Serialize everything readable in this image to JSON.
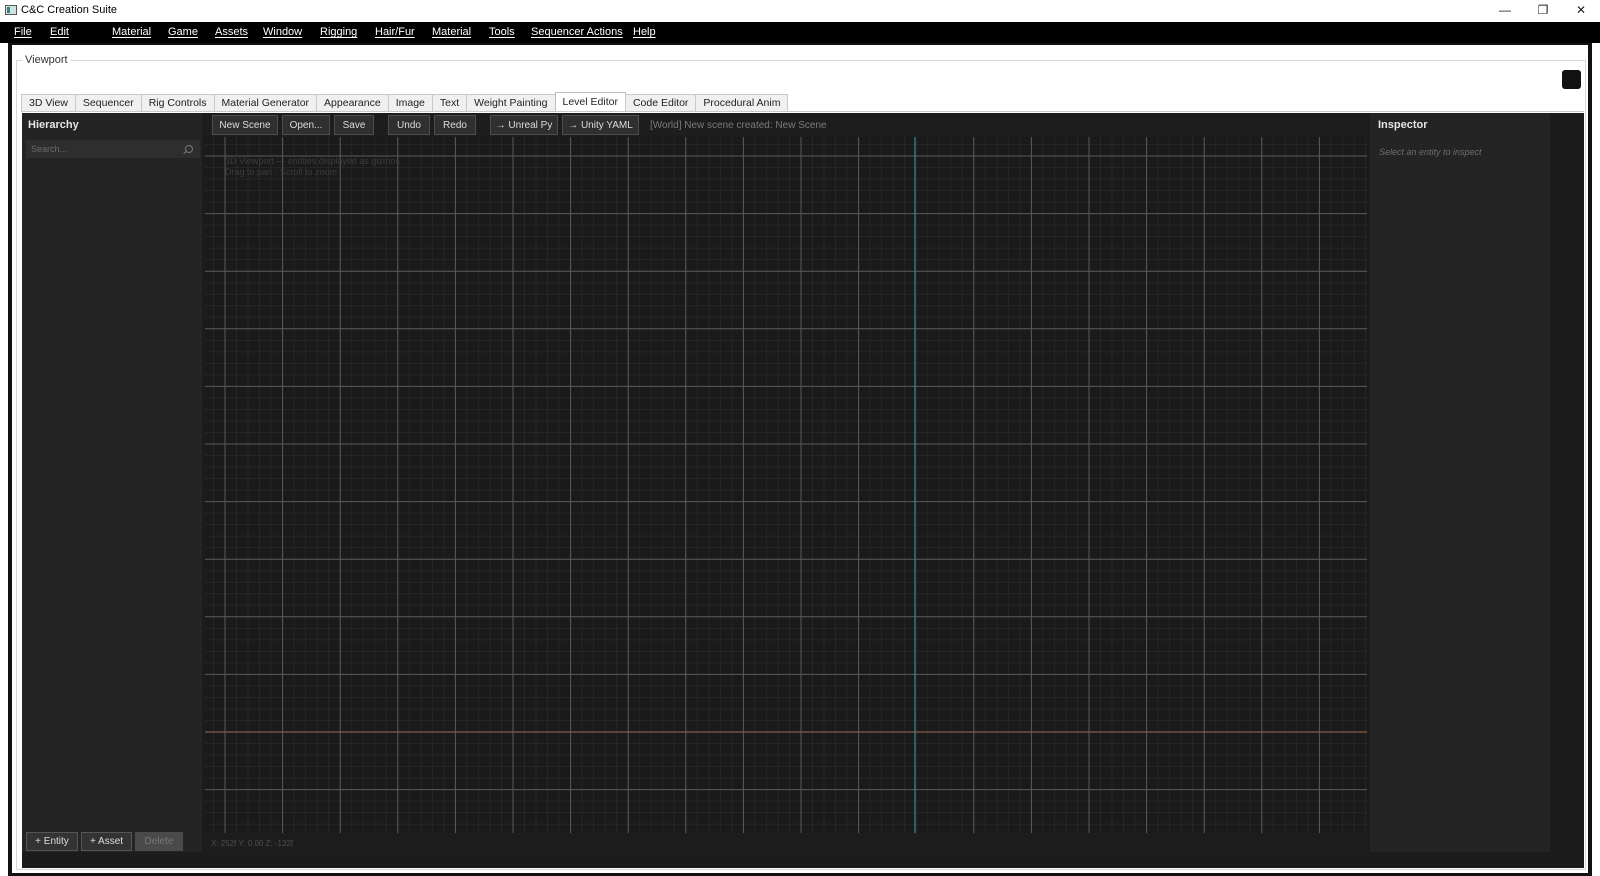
{
  "window": {
    "title": "C&C Creation Suite",
    "controls": [
      "—",
      "❐",
      "✕"
    ]
  },
  "menu": [
    "File",
    "Edit",
    "Material",
    "Game",
    "Assets",
    "Window",
    "Rigging",
    "Hair/Fur",
    "Material",
    "Tools",
    "Sequencer Actions",
    "Help"
  ],
  "groupbox": {
    "title": "Viewport"
  },
  "tabs": [
    "3D View",
    "Sequencer",
    "Rig Controls",
    "Material Generator",
    "Appearance",
    "Image",
    "Text",
    "Weight Painting",
    "Level Editor",
    "Code Editor",
    "Procedural Anim"
  ],
  "active_tab": "Level Editor",
  "hierarchy": {
    "title": "Hierarchy",
    "search_placeholder": "Search...",
    "add_entity": "+ Entity",
    "add_asset": "+ Asset",
    "delete": "Delete"
  },
  "toolbar": {
    "new_scene": "New Scene",
    "open": "Open...",
    "save": "Save",
    "undo": "Undo",
    "redo": "Redo",
    "export_unreal": "→ Unreal Py",
    "export_unity": "→ Unity YAML",
    "status": "[World] New scene created: New Scene"
  },
  "viewport": {
    "hint_line1": "3D Viewport — entities displayed as gizmos",
    "hint_line2": "Drag to pan · Scroll to zoom",
    "coords": "X: 252f  Y: 0.00  Z: -132f"
  },
  "inspector": {
    "title": "Inspector",
    "empty_hint": "Select an entity to inspect"
  },
  "colors": {
    "menubar_bg": "#000000",
    "panel_bg": "#242424",
    "viewport_bg": "#1a1a1a",
    "grid_major": "#5a5a5a",
    "axis_x": "#8a5a4a",
    "axis_z": "#3a8a8a"
  }
}
